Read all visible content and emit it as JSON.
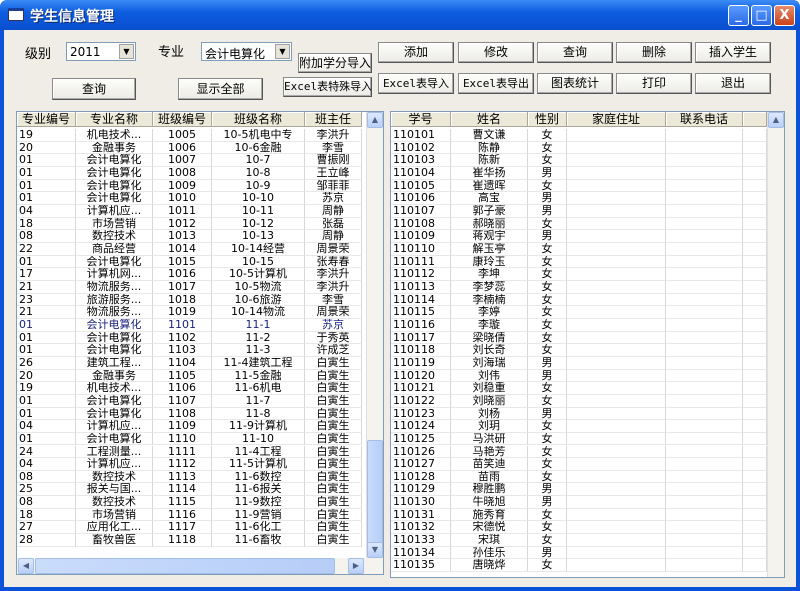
{
  "window": {
    "title": "学生信息管理",
    "minimize": "_",
    "maximize": "□",
    "close": "X"
  },
  "filters": {
    "grade_label": "级别",
    "grade_value": "2011",
    "major_label": "专业",
    "major_value": "会计电算化"
  },
  "buttons": {
    "query_left": "查询",
    "show_all": "显示全部",
    "extra_credit_import": "附加学分导入",
    "excel_special_import": "Excel表特殊导入",
    "add": "添加",
    "modify": "修改",
    "query": "查询",
    "delete": "删除",
    "insert_student": "插入学生",
    "excel_import": "Excel表导入",
    "excel_export": "Excel表导出",
    "chart_stats": "图表统计",
    "print": "打印",
    "exit": "退出"
  },
  "class_table": {
    "columns": [
      "专业编号",
      "专业名称",
      "班级编号",
      "班级名称",
      "班主任"
    ],
    "rows": [
      [
        "19",
        "机电技术...",
        "1005",
        "10-5机电中专",
        "李洪升"
      ],
      [
        "20",
        "金融事务",
        "1006",
        "10-6金融",
        "李雪"
      ],
      [
        "01",
        "会计电算化",
        "1007",
        "10-7",
        "曹振刚"
      ],
      [
        "01",
        "会计电算化",
        "1008",
        "10-8",
        "王立峰"
      ],
      [
        "01",
        "会计电算化",
        "1009",
        "10-9",
        "邹菲菲"
      ],
      [
        "01",
        "会计电算化",
        "1010",
        "10-10",
        "苏京"
      ],
      [
        "04",
        "计算机应...",
        "1011",
        "10-11",
        "周静"
      ],
      [
        "18",
        "市场营销",
        "1012",
        "10-12",
        "张磊"
      ],
      [
        "08",
        "数控技术",
        "1013",
        "10-13",
        "周静"
      ],
      [
        "22",
        "商品经营",
        "1014",
        "10-14经营",
        "周景荣"
      ],
      [
        "01",
        "会计电算化",
        "1015",
        "10-15",
        "张寿春"
      ],
      [
        "17",
        "计算机网...",
        "1016",
        "10-5计算机",
        "李洪升"
      ],
      [
        "21",
        "物流服务...",
        "1017",
        "10-5物流",
        "李洪升"
      ],
      [
        "23",
        "旅游服务...",
        "1018",
        "10-6旅游",
        "李雪"
      ],
      [
        "21",
        "物流服务...",
        "1019",
        "10-14物流",
        "周景荣"
      ],
      [
        "01",
        "会计电算化",
        "1101",
        "11-1",
        "苏京"
      ],
      [
        "01",
        "会计电算化",
        "1102",
        "11-2",
        "于秀英"
      ],
      [
        "01",
        "会计电算化",
        "1103",
        "11-3",
        "许成芝"
      ],
      [
        "26",
        "建筑工程...",
        "1104",
        "11-4建筑工程",
        "白寅生"
      ],
      [
        "20",
        "金融事务",
        "1105",
        "11-5金融",
        "白寅生"
      ],
      [
        "19",
        "机电技术...",
        "1106",
        "11-6机电",
        "白寅生"
      ],
      [
        "01",
        "会计电算化",
        "1107",
        "11-7",
        "白寅生"
      ],
      [
        "01",
        "会计电算化",
        "1108",
        "11-8",
        "白寅生"
      ],
      [
        "04",
        "计算机应...",
        "1109",
        "11-9计算机",
        "白寅生"
      ],
      [
        "01",
        "会计电算化",
        "1110",
        "11-10",
        "白寅生"
      ],
      [
        "24",
        "工程测量...",
        "1111",
        "11-4工程",
        "白寅生"
      ],
      [
        "04",
        "计算机应...",
        "1112",
        "11-5计算机",
        "白寅生"
      ],
      [
        "08",
        "数控技术",
        "1113",
        "11-6数控",
        "白寅生"
      ],
      [
        "25",
        "报关与国...",
        "1114",
        "11-6报关",
        "白寅生"
      ],
      [
        "08",
        "数控技术",
        "1115",
        "11-9数控",
        "白寅生"
      ],
      [
        "18",
        "市场营销",
        "1116",
        "11-9营销",
        "白寅生"
      ],
      [
        "27",
        "应用化工...",
        "1117",
        "11-6化工",
        "白寅生"
      ],
      [
        "28",
        "畜牧兽医",
        "1118",
        "11-6畜牧",
        "白寅生"
      ]
    ],
    "selected_row_index": 15,
    "selected_color": "#1a237e"
  },
  "student_table": {
    "columns": [
      "学号",
      "姓名",
      "性别",
      "家庭住址",
      "联系电话"
    ],
    "rows": [
      [
        "110101",
        "曹文谦",
        "女"
      ],
      [
        "110102",
        "陈静",
        "女"
      ],
      [
        "110103",
        "陈新",
        "女"
      ],
      [
        "110104",
        "崔华扬",
        "男"
      ],
      [
        "110105",
        "崔遗晖",
        "女"
      ],
      [
        "110106",
        "高宝",
        "男"
      ],
      [
        "110107",
        "郭子豪",
        "男"
      ],
      [
        "110108",
        "郝晓丽",
        "女"
      ],
      [
        "110109",
        "蒋观宇",
        "男"
      ],
      [
        "110110",
        "解玉亭",
        "女"
      ],
      [
        "110111",
        "康玲玉",
        "女"
      ],
      [
        "110112",
        "李坤",
        "女"
      ],
      [
        "110113",
        "李梦蕊",
        "女"
      ],
      [
        "110114",
        "李楠楠",
        "女"
      ],
      [
        "110115",
        "李婷",
        "女"
      ],
      [
        "110116",
        "李璇",
        "女"
      ],
      [
        "110117",
        "梁晓倩",
        "女"
      ],
      [
        "110118",
        "刘长奇",
        "女"
      ],
      [
        "110119",
        "刘海瑞",
        "男"
      ],
      [
        "110120",
        "刘伟",
        "男"
      ],
      [
        "110121",
        "刘稳重",
        "女"
      ],
      [
        "110122",
        "刘晓丽",
        "女"
      ],
      [
        "110123",
        "刘杨",
        "男"
      ],
      [
        "110124",
        "刘玥",
        "女"
      ],
      [
        "110125",
        "马洪研",
        "女"
      ],
      [
        "110126",
        "马艳芳",
        "女"
      ],
      [
        "110127",
        "苗笑迪",
        "女"
      ],
      [
        "110128",
        "苗雨",
        "女"
      ],
      [
        "110129",
        "穆胜鹏",
        "男"
      ],
      [
        "110130",
        "牛晓旭",
        "男"
      ],
      [
        "110131",
        "施秀育",
        "女"
      ],
      [
        "110132",
        "宋德悦",
        "女"
      ],
      [
        "110133",
        "宋琪",
        "女"
      ],
      [
        "110134",
        "孙佳乐",
        "男"
      ],
      [
        "110135",
        "唐晓烨",
        "女"
      ]
    ]
  }
}
